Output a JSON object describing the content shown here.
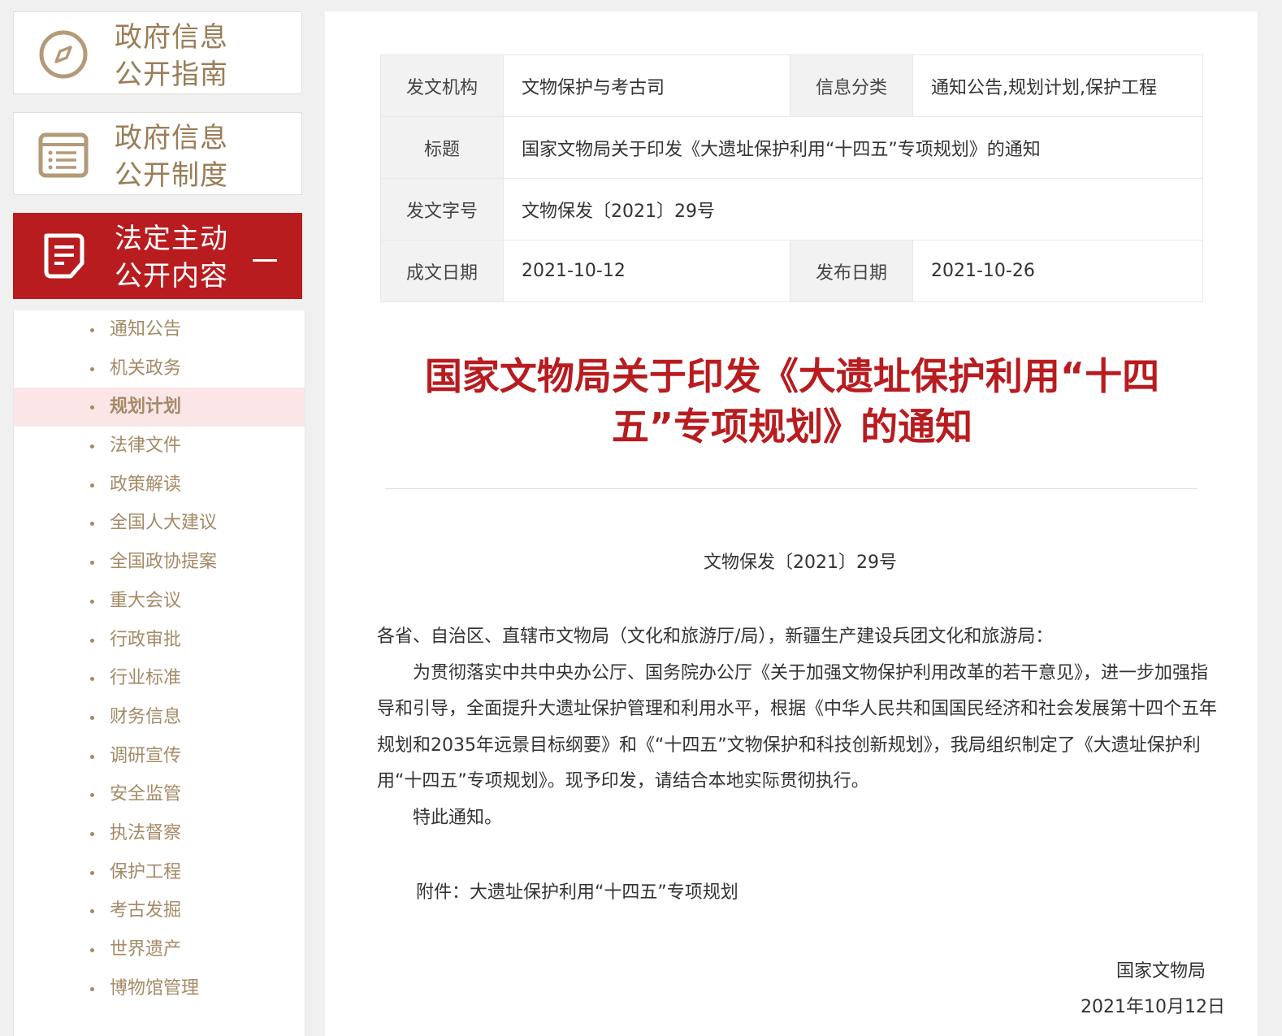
{
  "sidebar": {
    "boxes": [
      {
        "label_line1": "政府信息",
        "label_line2": "公开指南",
        "icon": "compass-icon"
      },
      {
        "label_line1": "政府信息",
        "label_line2": "公开制度",
        "icon": "list-icon"
      },
      {
        "label_line1": "法定主动",
        "label_line2": "公开内容",
        "icon": "document-icon",
        "toggle": "collapse"
      }
    ],
    "submenu": [
      "通知公告",
      "机关政务",
      "规划计划",
      "法律文件",
      "政策解读",
      "全国人大建议",
      "全国政协提案",
      "重大会议",
      "行政审批",
      "行业标准",
      "财务信息",
      "调研宣传",
      "安全监管",
      "执法督察",
      "保护工程",
      "考古发掘",
      "世界遗产",
      "博物馆管理"
    ],
    "current": "规划计划"
  },
  "meta": {
    "issuer_label": "发文机构",
    "issuer": "文物保护与考古司",
    "category_label": "信息分类",
    "category": "通知公告,规划计划,保护工程",
    "title_label": "标题",
    "title": "国家文物局关于印发《大遗址保护利用“十四五”专项规划》的通知",
    "docno_label": "发文字号",
    "docno": "文物保发〔2021〕29号",
    "written_label": "成文日期",
    "written": "2021-10-12",
    "published_label": "发布日期",
    "published": "2021-10-26"
  },
  "article": {
    "title_line1": "国家文物局关于印发《大遗址保护利用“十四",
    "title_line2": "五”专项规划》的通知",
    "docno": "文物保发〔2021〕29号",
    "salutation": "各省、自治区、直辖市文物局（文化和旅游厅/局），新疆生产建设兵团文化和旅游局：",
    "para1": "为贯彻落实中共中央办公厅、国务院办公厅《关于加强文物保护利用改革的若干意见》，进一步加强指导和引导，全面提升大遗址保护管理和利用水平，根据《中华人民共和国国民经济和社会发展第十四个五年规划和2035年远景目标纲要》和《“十四五”文物保护和科技创新规划》，我局组织制定了《大遗址保护利用“十四五”专项规划》。现予印发，请结合本地实际贯彻执行。",
    "para2": "特此通知。",
    "attachment": "附件：大遗址保护利用“十四五”专项规划",
    "sign_org": "国家文物局",
    "sign_date": "2021年10月12日"
  },
  "colors": {
    "accent": "#b81c1f",
    "gold": "#9a7d57",
    "highlight": "#fbe5e6"
  }
}
